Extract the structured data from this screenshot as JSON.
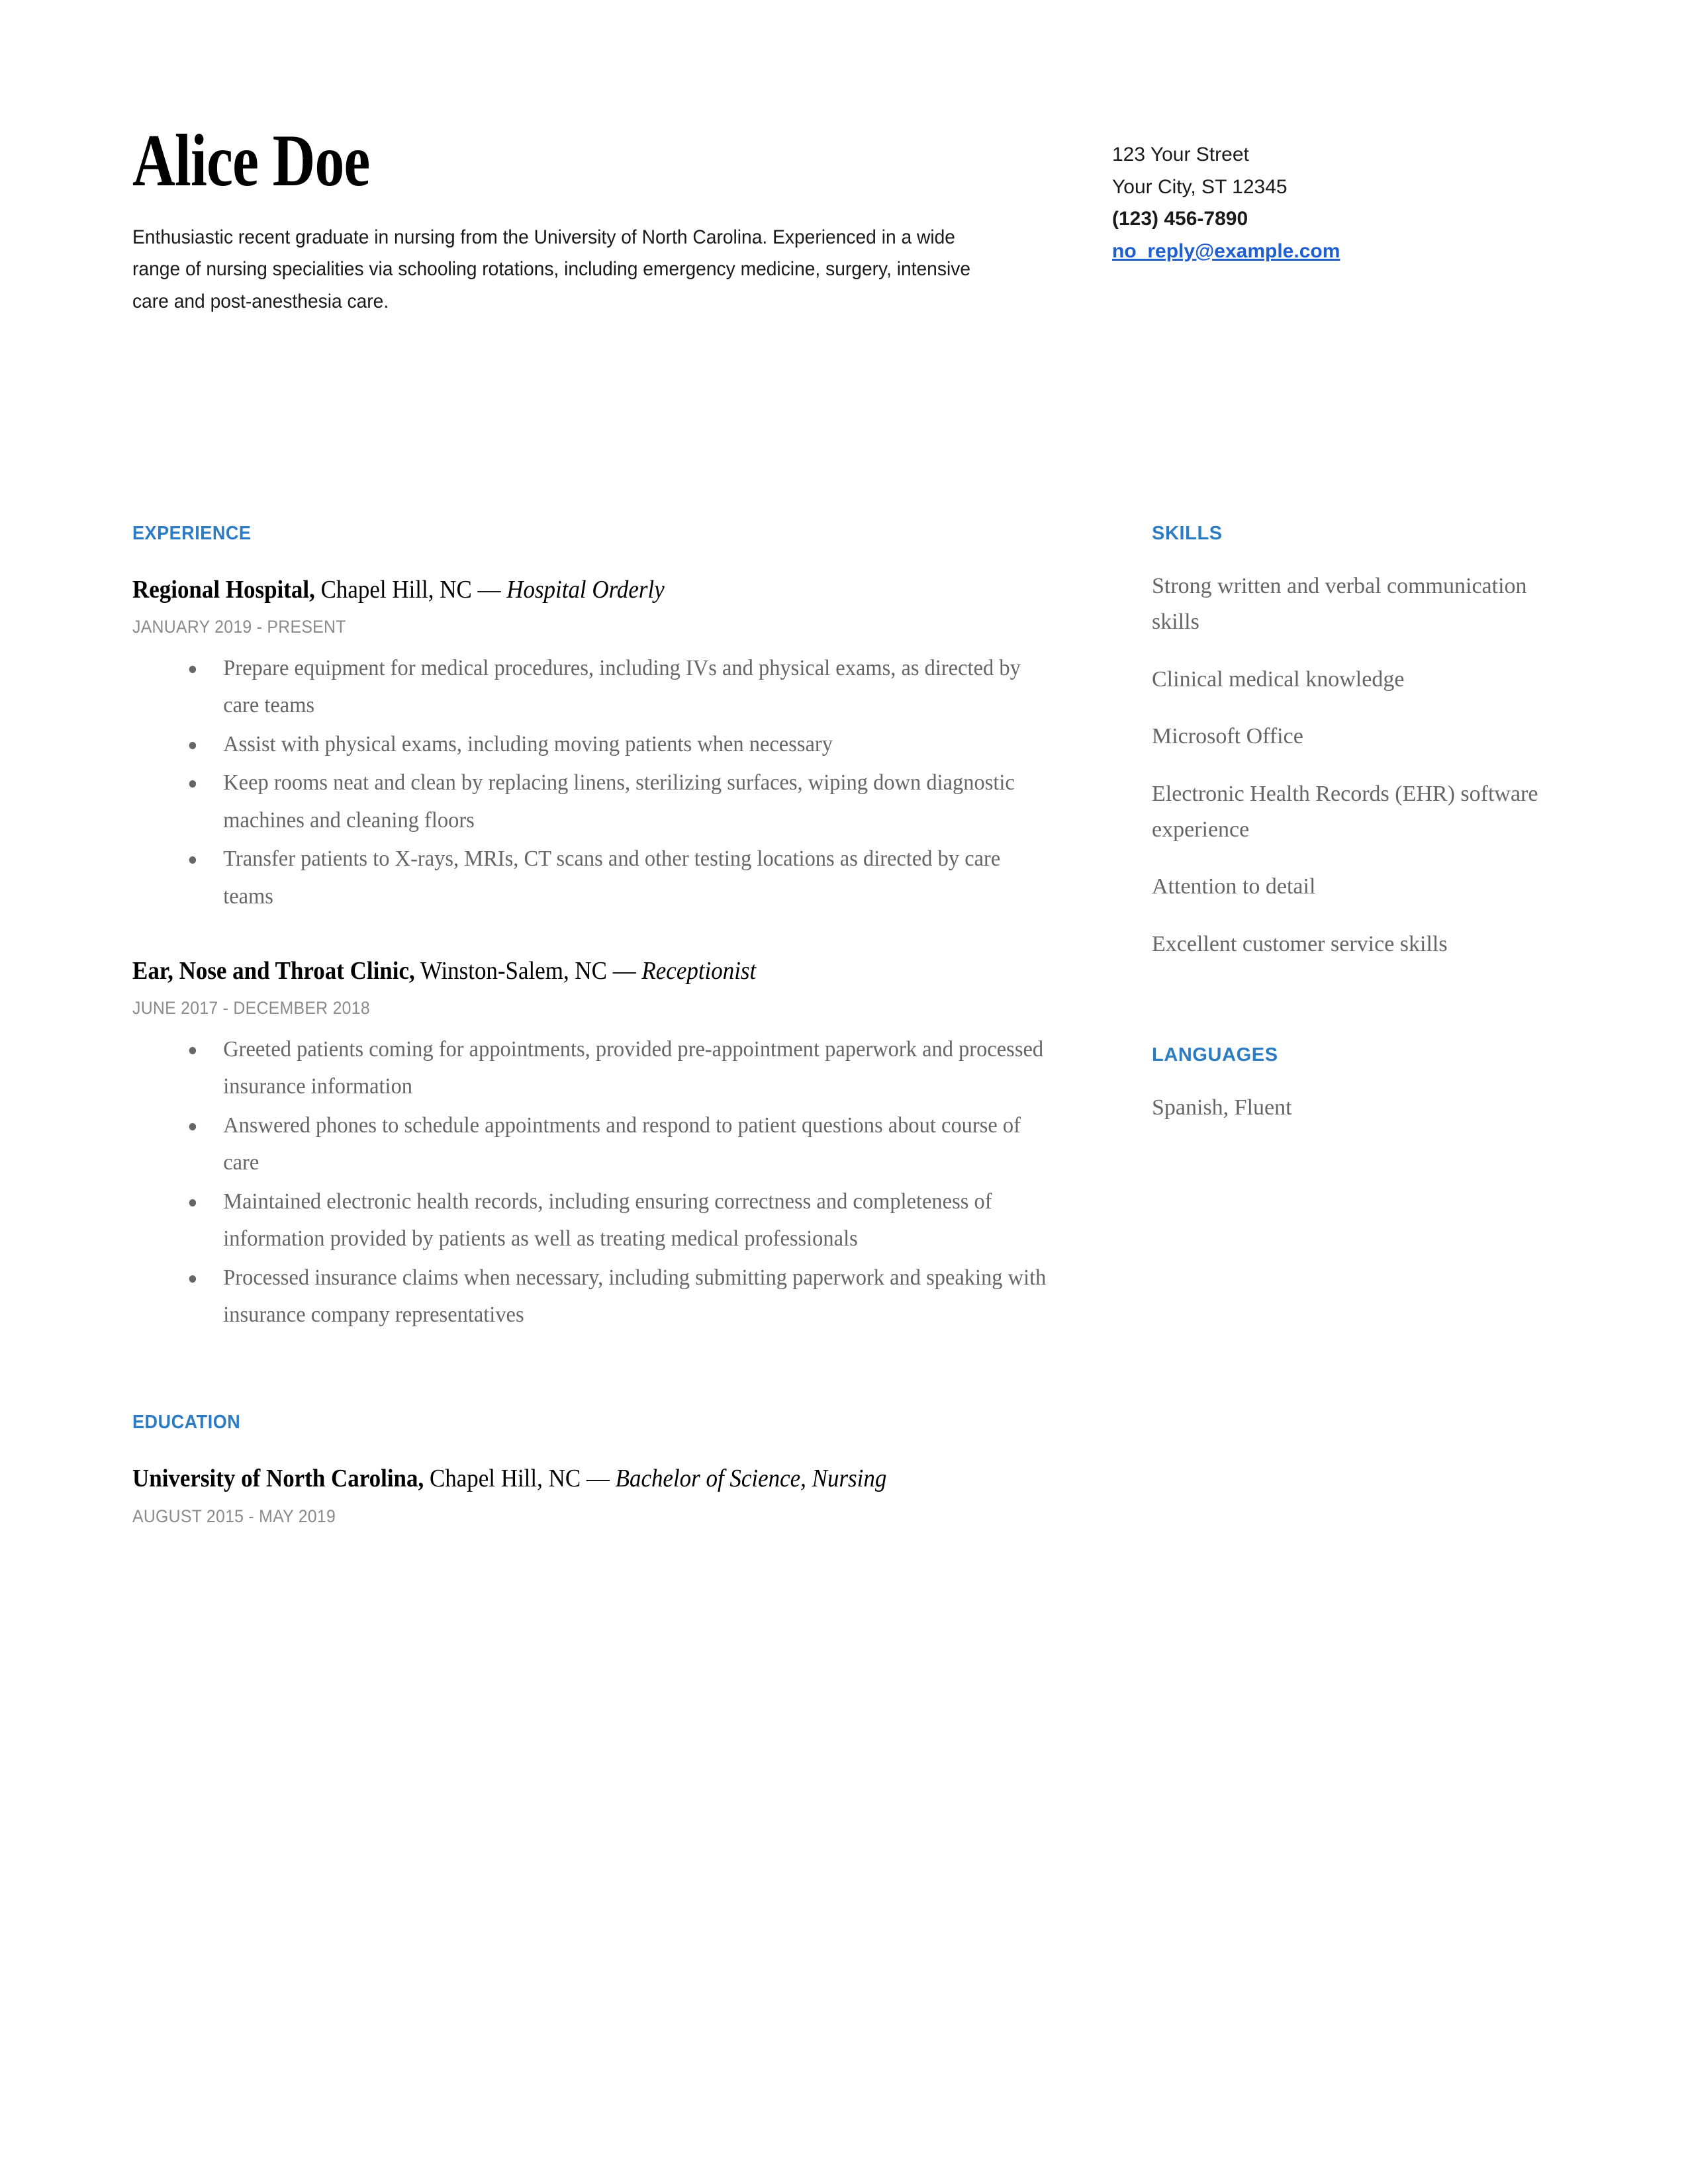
{
  "header": {
    "name": "Alice Doe",
    "summary": "Enthusiastic recent graduate in nursing from the University of North Carolina. Experienced in a wide range of nursing specialities via schooling rotations, including emergency medicine, surgery, intensive care and post-anesthesia care.",
    "contact": {
      "street": "123 Your Street",
      "city_state_zip": "Your City, ST 12345",
      "phone": "(123) 456-7890",
      "email": "no_reply@example.com"
    }
  },
  "accent_color": "#2b7cc4",
  "link_color": "#1f5fd0",
  "body_text_color": "#666666",
  "date_text_color": "#8a8a8a",
  "experience": {
    "section_title": "EXPERIENCE",
    "entries": [
      {
        "organization": "Regional Hospital,",
        "location": " Chapel Hill, NC — ",
        "role": "Hospital Orderly",
        "date": "JANUARY 2019 - PRESENT",
        "bullets": [
          "Prepare equipment for medical procedures, including IVs and physical exams, as directed by care teams",
          "Assist with physical exams, including moving patients when necessary",
          "Keep rooms neat and clean by replacing linens, sterilizing surfaces, wiping down diagnostic machines and cleaning floors",
          "Transfer patients to X-rays, MRIs, CT scans and other testing locations as directed by care teams"
        ]
      },
      {
        "organization": "Ear, Nose and Throat Clinic,",
        "location": " Winston-Salem, NC — ",
        "role": "Receptionist",
        "date": "JUNE 2017 - DECEMBER 2018",
        "bullets": [
          "Greeted patients coming for appointments, provided pre-appointment paperwork and processed insurance information",
          "Answered phones to schedule appointments and respond to patient questions about course of care",
          "Maintained electronic health records, including ensuring correctness and completeness of information provided by patients as well as treating medical professionals",
          "Processed insurance claims when necessary, including submitting paperwork and speaking with insurance company representatives"
        ]
      }
    ]
  },
  "education": {
    "section_title": "EDUCATION",
    "entries": [
      {
        "organization": "University of North Carolina,",
        "location": " Chapel Hill, NC — ",
        "role": "Bachelor of Science, Nursing",
        "date": "AUGUST 2015 - MAY 2019"
      }
    ]
  },
  "skills": {
    "section_title": "SKILLS",
    "items": [
      "Strong written and verbal communication skills",
      "Clinical medical knowledge",
      "Microsoft Office",
      "Electronic Health Records (EHR) software experience",
      "Attention to detail",
      "Excellent customer service skills"
    ]
  },
  "languages": {
    "section_title": "LANGUAGES",
    "items": [
      "Spanish, Fluent"
    ]
  }
}
